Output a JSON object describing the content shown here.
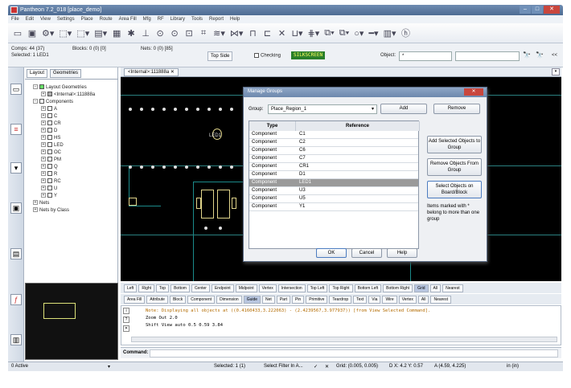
{
  "window": {
    "title": "Pantheon  7.2_018  [place_demo]"
  },
  "menu": [
    "File",
    "Edit",
    "View",
    "Settings",
    "Place",
    "Route",
    "Area Fill",
    "Mfg",
    "RF",
    "Library",
    "Tools",
    "Report",
    "Help"
  ],
  "info": {
    "comps": "Comps: 44 (37)",
    "blocks": "Blocks: 0 (0) [0]",
    "nets": "Nets: 0 (0) [85]",
    "selected": "Selected: 1 LED1"
  },
  "layerbar": {
    "side": "Top Side",
    "checking": "Checking",
    "layer": "SILKSCREEN",
    "object_label": "Object:",
    "object_value": "*"
  },
  "panel": {
    "tabs": [
      "Layout",
      "Geometries"
    ],
    "tree": [
      "Layout Geometries",
      "<Internal>:111888a",
      "Components",
      "A",
      "C",
      "CR",
      "D",
      "HS",
      "LED",
      "OC",
      "PM",
      "Q",
      "R",
      "RC",
      "U",
      "Y",
      "Nets",
      "Nets by Class"
    ]
  },
  "doc_tab": "<Internal>:111888a",
  "canvas_label": "LED1",
  "dialog": {
    "title": "Manage Groups",
    "group_label": "Group:",
    "group_value": "Place_Region_1",
    "add": "Add",
    "remove": "Remove",
    "col_type": "Type",
    "col_ref": "Reference",
    "rows": [
      {
        "type": "Component",
        "ref": "C1"
      },
      {
        "type": "Component",
        "ref": "C2"
      },
      {
        "type": "Component",
        "ref": "C6"
      },
      {
        "type": "Component",
        "ref": "C7"
      },
      {
        "type": "Component",
        "ref": "CR1"
      },
      {
        "type": "Component",
        "ref": "D1"
      },
      {
        "type": "Component",
        "ref": "LED1"
      },
      {
        "type": "Component",
        "ref": "U3"
      },
      {
        "type": "Component",
        "ref": "U5"
      },
      {
        "type": "Component",
        "ref": "Y1"
      }
    ],
    "highlight_row": 6,
    "btn_add_selected": "Add Selected Objects to Group",
    "btn_remove_objects": "Remove Objects From Group",
    "btn_select_objects": "Select Objects on Board/Block",
    "note": "Items marked with * belong to more than one group",
    "ok": "OK",
    "cancel": "Cancel",
    "help": "Help"
  },
  "snaps": [
    "Left",
    "Right",
    "Top",
    "Bottom",
    "Center",
    "Endpoint",
    "Midpoint",
    "Vertex",
    "Intersection",
    "Top Left",
    "Top Right",
    "Bottom Left",
    "Bottom Right",
    "Grid",
    "All",
    "Nearest"
  ],
  "snap_active": "Grid",
  "filters": [
    "Area Fill",
    "Attribute",
    "Block",
    "Component",
    "Dimension",
    "Guide",
    "Net",
    "Part",
    "Pin",
    "Primitive",
    "Teardrop",
    "Text",
    "Via",
    "Wire",
    "Vertex",
    "All",
    "Nearest"
  ],
  "filter_active": "Guide",
  "console": [
    "Note: Displaying all objects at ((0.4160433,3.222063) - (2.4239567,3.977937)) [from View Selected Command].",
    "Zoom Out 2.0",
    "Shift View auto 0.5 0.59 3.84"
  ],
  "command_label": "Command:",
  "status": {
    "mode": "0 Active",
    "selected": "Selected: 1 (1)",
    "filter": "Select Filter In A...",
    "grid": "Grid: (0.005, 0.005)",
    "d": "D  X: 4.2  Y: 0.57",
    "a": "A (4.59, 4.225)",
    "units": "in (in)"
  },
  "colors": {
    "canvas": "#000000",
    "trace": "#1b8a8a",
    "pad": "#e0d48a",
    "highlight": "#9a9a9a",
    "close": "#c9463d"
  }
}
